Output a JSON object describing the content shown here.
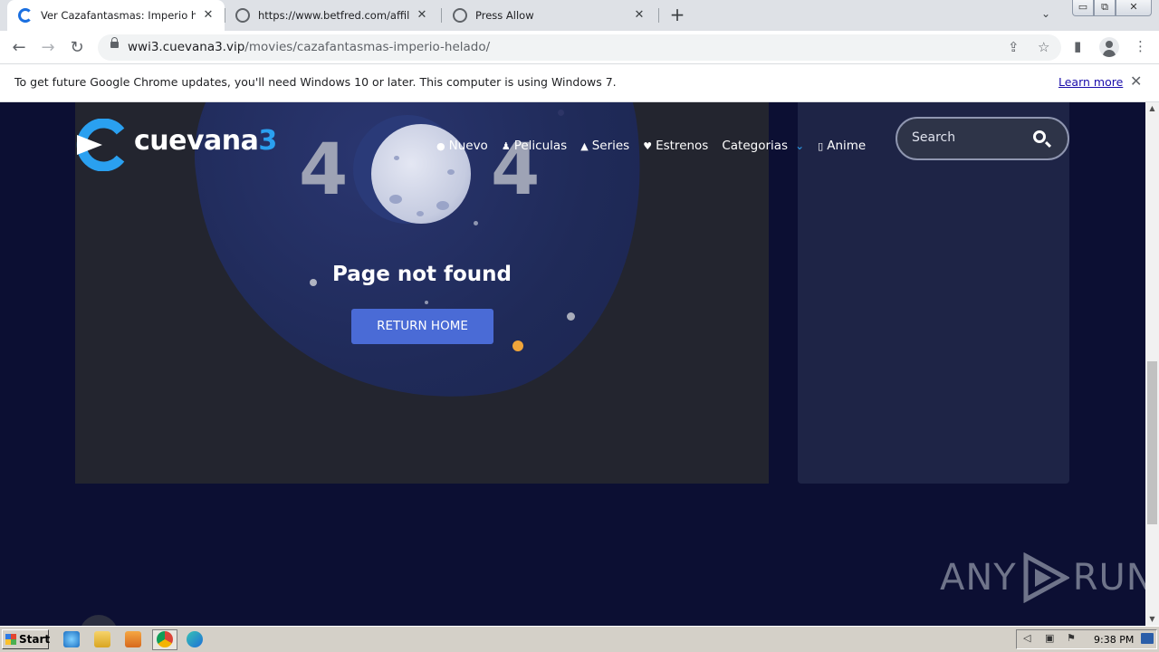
{
  "browser": {
    "tabs": [
      {
        "title": "Ver Cazafantasmas: Imperio helado",
        "active": true
      },
      {
        "title": "https://www.betfred.com/affiliate/b",
        "active": false
      },
      {
        "title": "Press Allow",
        "active": false
      }
    ],
    "tab_close": "✕",
    "new_tab": "+",
    "tab_search": "⌄",
    "window_controls": {
      "minimize": "▭",
      "restore": "⧉",
      "close": "✕"
    },
    "url_host": "wwi3.cuevana3.vip",
    "url_path": "/movies/cazafantasmas-imperio-helado/",
    "nav": {
      "back": "←",
      "forward": "→",
      "reload": "↻"
    },
    "icons": {
      "share": "⇪",
      "bookmark": "☆",
      "side_panel": "▮",
      "menu": "⋮"
    }
  },
  "infobar": {
    "message": "To get future Google Chrome updates, you'll need Windows 10 or later. This computer is using Windows 7.",
    "link": "Learn more",
    "close": "✕"
  },
  "site": {
    "logo_text": "cuevana",
    "logo_num": "3",
    "nav": [
      {
        "icon": "flame-icon",
        "glyph": "🔥",
        "label": "Nuevo"
      },
      {
        "icon": "person-icon",
        "glyph": "♟",
        "label": "Peliculas"
      },
      {
        "icon": "triangle-icon",
        "glyph": "▲",
        "label": "Series"
      },
      {
        "icon": "heart-icon",
        "glyph": "♥",
        "label": "Estrenos"
      },
      {
        "icon": "",
        "glyph": "",
        "label": "Categorias"
      },
      {
        "icon": "box-icon",
        "glyph": "▯",
        "label": "Anime"
      }
    ],
    "search_placeholder": "Search",
    "error": {
      "digit_left": "4",
      "digit_right": "4",
      "title": "Page not found",
      "button": "RETURN HOME"
    },
    "watermark_left": "ANY",
    "watermark_right": "RUN"
  },
  "taskbar": {
    "start": "Start",
    "time": "9:38 PM"
  },
  "colors": {
    "page_bg": "#0c0f33",
    "panel": "#23252f",
    "accent": "#2aa0f0",
    "button": "#4a6bd6"
  }
}
